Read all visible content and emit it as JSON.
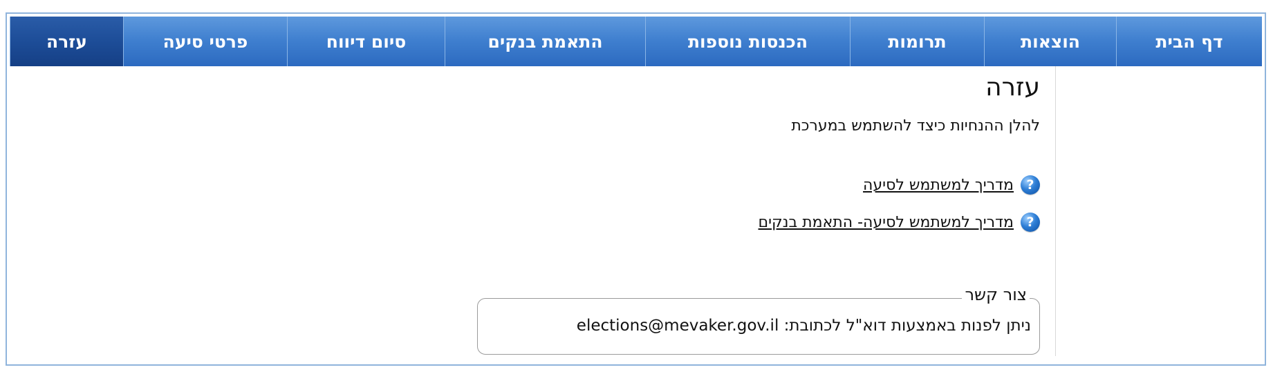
{
  "nav": {
    "tabs": [
      {
        "label": "דף הבית",
        "active": false
      },
      {
        "label": "הוצאות",
        "active": false
      },
      {
        "label": "תרומות",
        "active": false
      },
      {
        "label": "הכנסות נוספות",
        "active": false
      },
      {
        "label": "התאמת בנקים",
        "active": false
      },
      {
        "label": "סיום דיווח",
        "active": false
      },
      {
        "label": "פרטי סיעה",
        "active": false
      },
      {
        "label": "עזרה",
        "active": true
      }
    ]
  },
  "page": {
    "title": "עזרה",
    "intro": "להלן ההנחיות כיצד להשתמש במערכת"
  },
  "guides": [
    {
      "label": "מדריך למשתמש לסיעה",
      "icon": "help-icon"
    },
    {
      "label": "מדריך למשתמש לסיעה- התאמת בנקים",
      "icon": "help-icon"
    }
  ],
  "contact": {
    "legend": "צור קשר",
    "text": "ניתן לפנות באמצעות דוא\"ל לכתובת:",
    "email": "elections@mevaker.gov.il"
  },
  "colors": {
    "nav_bg": "#3f7fcf",
    "nav_active": "#1d4d98",
    "frame_border": "#8fb4dc"
  }
}
